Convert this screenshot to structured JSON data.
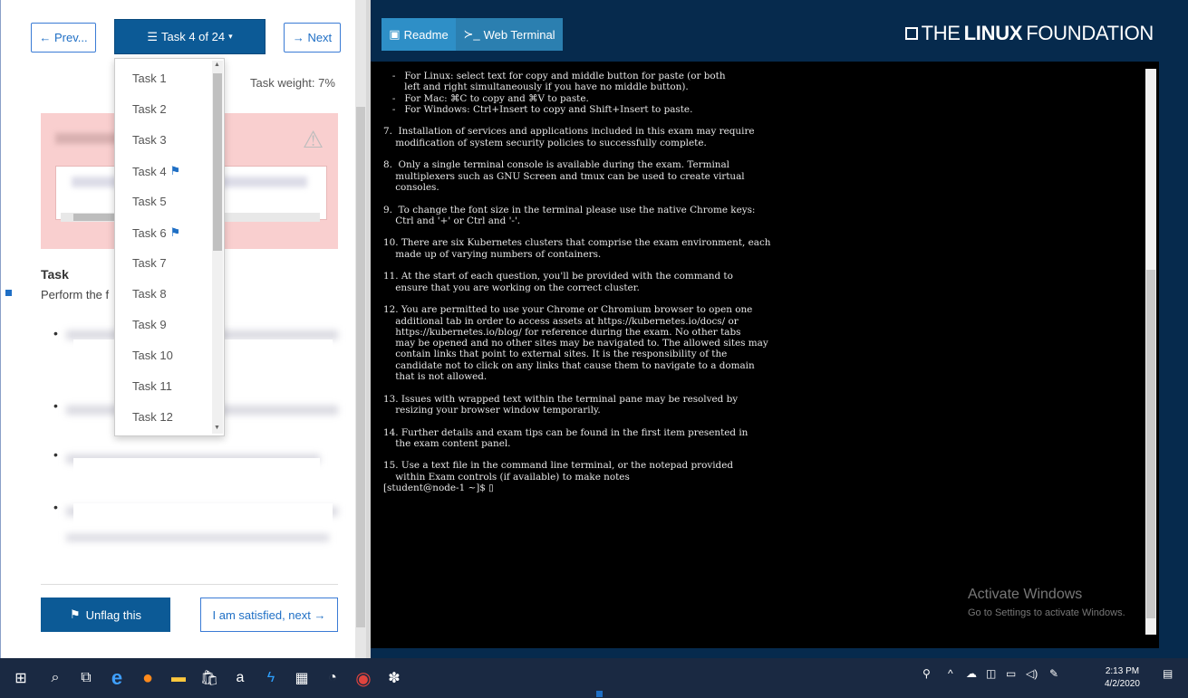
{
  "nav": {
    "prev_label": "← Prev...",
    "task_selector_label": "Task 4 of 24",
    "next_label": "→ Next",
    "task_weight": "Task weight: 7%"
  },
  "dropdown": {
    "items": [
      {
        "label": "Task 1",
        "flagged": false
      },
      {
        "label": "Task 2",
        "flagged": false
      },
      {
        "label": "Task 3",
        "flagged": false
      },
      {
        "label": "Task 4",
        "flagged": true
      },
      {
        "label": "Task 5",
        "flagged": false
      },
      {
        "label": "Task 6",
        "flagged": true
      },
      {
        "label": "Task 7",
        "flagged": false
      },
      {
        "label": "Task 8",
        "flagged": false
      },
      {
        "label": "Task 9",
        "flagged": false
      },
      {
        "label": "Task 10",
        "flagged": false
      },
      {
        "label": "Task 11",
        "flagged": false
      },
      {
        "label": "Task 12",
        "flagged": false
      }
    ]
  },
  "task": {
    "heading": "Task",
    "intro": "Perform the f"
  },
  "buttons": {
    "unflag_label": "Unflag this",
    "satisfied_label": "I am satisfied, next →"
  },
  "tabs": {
    "readme_label": "Readme",
    "terminal_label": "Web Terminal"
  },
  "brand": {
    "the": "THE",
    "linux": "LINUX",
    "foundation": "FOUNDATION"
  },
  "terminal": {
    "lines": [
      "   -   For Linux: select text for copy and middle button for paste (or both",
      "       left and right simultaneously if you have no middle button).",
      "   -   For Mac: ⌘C to copy and ⌘V to paste.",
      "   -   For Windows: Ctrl+Insert to copy and Shift+Insert to paste.",
      "",
      "7.  Installation of services and applications included in this exam may require",
      "    modification of system security policies to successfully complete.",
      "",
      "8.  Only a single terminal console is available during the exam. Terminal",
      "    multiplexers such as GNU Screen and tmux can be used to create virtual",
      "    consoles.",
      "",
      "9.  To change the font size in the terminal please use the native Chrome keys:",
      "    Ctrl and '+' or Ctrl and '-'.",
      "",
      "10. There are six Kubernetes clusters that comprise the exam environment, each",
      "    made up of varying numbers of containers.",
      "",
      "11. At the start of each question, you'll be provided with the command to",
      "    ensure that you are working on the correct cluster.",
      "",
      "12. You are permitted to use your Chrome or Chromium browser to open one",
      "    additional tab in order to access assets at https://kubernetes.io/docs/ or",
      "    https://kubernetes.io/blog/ for reference during the exam. No other tabs",
      "    may be opened and no other sites may be navigated to. The allowed sites may",
      "    contain links that point to external sites. It is the responsibility of the",
      "    candidate not to click on any links that cause them to navigate to a domain",
      "    that is not allowed.",
      "",
      "13. Issues with wrapped text within the terminal pane may be resolved by",
      "    resizing your browser window temporarily.",
      "",
      "14. Further details and exam tips can be found in the first item presented in",
      "    the exam content panel.",
      "",
      "15. Use a text file in the command line terminal, or the notepad provided",
      "    within Exam controls (if available) to make notes",
      "[student@node-1 ~]$ ▯"
    ]
  },
  "watermark": {
    "title": "Activate Windows",
    "subtitle": "Go to Settings to activate Windows."
  },
  "taskbar": {
    "time": "2:13 PM",
    "date": "4/2/2020"
  },
  "colors": {
    "primary_blue": "#0c5a96",
    "header_navy": "#062a4d",
    "tab_blue": "#2e8fc7",
    "alert_pink": "#f9cfcf",
    "taskbar": "#1a2942"
  }
}
